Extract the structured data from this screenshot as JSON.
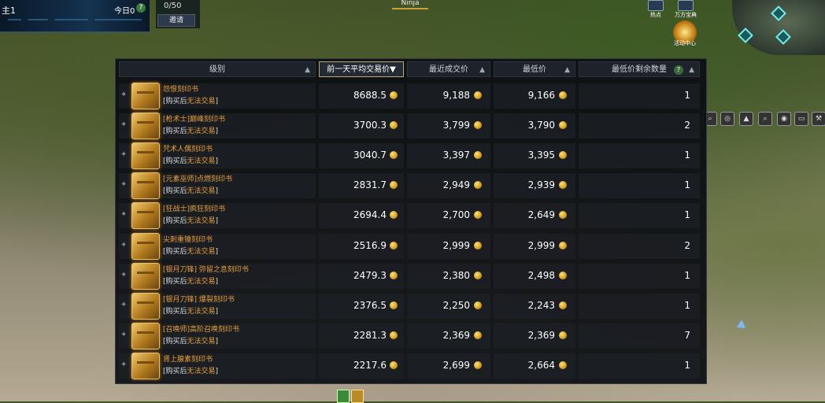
{
  "hud": {
    "player_name": "主1",
    "today_label": "今日0",
    "help_label": "?",
    "party_count": "0/50",
    "invite_label": "邀请",
    "character_tag": "Ninja",
    "hotspot_label": "热点",
    "treasure_label": "万方宝典",
    "event_label": "活动中心"
  },
  "table": {
    "headers": {
      "grade": "级别",
      "avg_price": "前一天平均交易价",
      "recent_price": "最近成交价",
      "lowest_price": "最低价",
      "lowest_qty": "最低价剩余数量"
    },
    "sort_up": "▲",
    "sort_down": "▼",
    "help_icon": "?",
    "note_open": "[",
    "note_orange": "购买后",
    "note_white": "无法交易",
    "note_close": "]",
    "rows": [
      {
        "name": "怨恨刻印书",
        "avg": "8688.5",
        "recent": "9,188",
        "lowest": "9,166",
        "qty": "1"
      },
      {
        "name": "[枪术士]巅峰刻印书",
        "avg": "3700.3",
        "recent": "3,799",
        "lowest": "3,790",
        "qty": "2"
      },
      {
        "name": "咒术人偶刻印书",
        "avg": "3040.7",
        "recent": "3,397",
        "lowest": "3,395",
        "qty": "1"
      },
      {
        "name": "[元素巫师]点燃刻印书",
        "avg": "2831.7",
        "recent": "2,949",
        "lowest": "2,939",
        "qty": "1"
      },
      {
        "name": "[狂战士]疯狂刻印书",
        "avg": "2694.4",
        "recent": "2,700",
        "lowest": "2,649",
        "qty": "1"
      },
      {
        "name": "尖刺重锤刻印书",
        "avg": "2516.9",
        "recent": "2,999",
        "lowest": "2,999",
        "qty": "2"
      },
      {
        "name": "[银月刀锋] 弥留之息刻印书",
        "avg": "2479.3",
        "recent": "2,380",
        "lowest": "2,498",
        "qty": "1"
      },
      {
        "name": "[银月刀锋] 爆裂刻印书",
        "avg": "2376.5",
        "recent": "2,250",
        "lowest": "2,243",
        "qty": "1"
      },
      {
        "name": "[召唤师]高阶召唤刻印书",
        "avg": "2281.3",
        "recent": "2,369",
        "lowest": "2,369",
        "qty": "7"
      },
      {
        "name": "肾上腺素刻印书",
        "avg": "2217.6",
        "recent": "2,699",
        "lowest": "2,664",
        "qty": "1"
      }
    ]
  },
  "colors": {
    "item_name": "#e8a040",
    "panel_bg": "#0c0e12",
    "active_header_border": "#b9a67a",
    "coin": "#c89216"
  }
}
